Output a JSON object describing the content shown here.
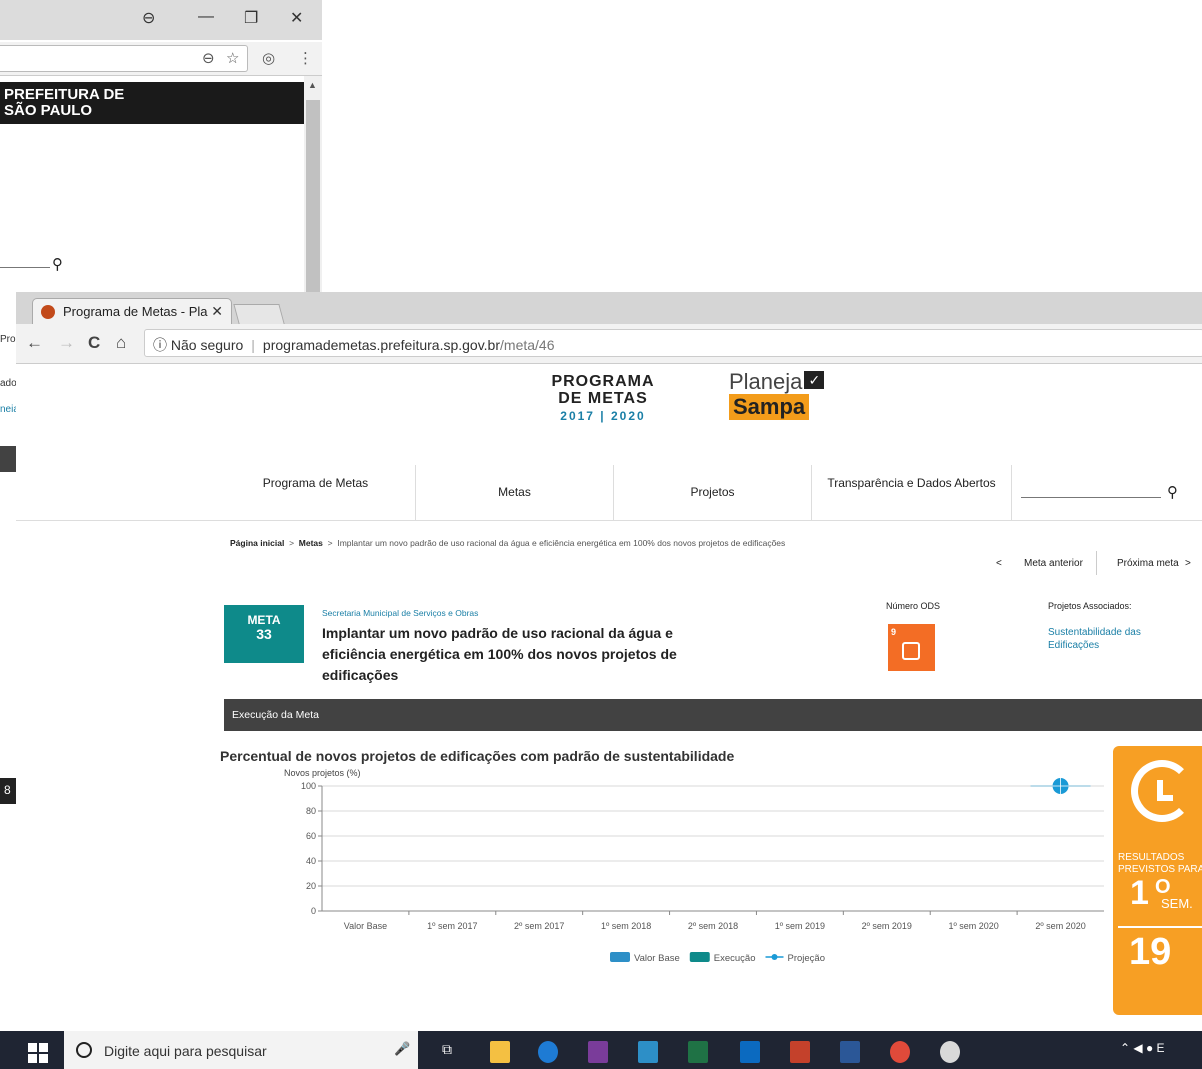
{
  "back_window": {
    "controls": {
      "account": "⊖",
      "minimize": "—",
      "restore": "❐",
      "close": "✕"
    },
    "omnibox_icons": {
      "zoom": "⊖",
      "star": "☆",
      "ext": "◎",
      "menu": "⋮"
    },
    "banner_lines": [
      "PREFEITURA DE",
      "SÃO PAULO"
    ]
  },
  "sliver": {
    "lines": [
      "Pro",
      "ados",
      "neia"
    ],
    "icon": "8"
  },
  "browser": {
    "tab_title": "Programa de Metas - Pla",
    "tab_close": "✕",
    "nav": {
      "back": "←",
      "forward": "→",
      "reload": "C",
      "home": "⌂"
    },
    "url": {
      "security": "ⓘ Não seguro",
      "host": "programademetas.prefeitura.sp.gov.br",
      "path": "/meta/46"
    }
  },
  "logos": {
    "programa": {
      "line1": "PROGRAMA",
      "line2": "DE METAS",
      "years": "2017 | 2020"
    },
    "planeja": {
      "line1": "Planeja",
      "line2": "Sampa"
    }
  },
  "main_nav": {
    "items": [
      "Programa de Metas",
      "Metas",
      "Projetos",
      "Transparência e Dados Abertos"
    ]
  },
  "breadcrumb": {
    "home": "Página inicial",
    "sep": ">",
    "metas": "Metas",
    "current": "Implantar um novo padrão de uso racional da água e eficiência energética em 100% dos novos projetos de edificações"
  },
  "meta_nav": {
    "prev_arrow": "<",
    "prev": "Meta anterior",
    "next": "Próxima meta",
    "next_arrow": ">"
  },
  "meta": {
    "badge_label": "META",
    "badge_number": "33",
    "secretaria": "Secretaria Municipal de Serviços e Obras",
    "title": "Implantar um novo padrão de uso racional da água e eficiência energética em 100% dos novos projetos de edificações",
    "ods_label": "Número ODS",
    "ods_number": "9",
    "projects_label": "Projetos Associados:",
    "projects_link": "Sustentabilidade das Edificações"
  },
  "execution": {
    "header": "Execução da Meta"
  },
  "chart_data": {
    "type": "line",
    "title": "Percentual de novos projetos de edificações com padrão de sustentabilidade",
    "ylabel": "Novos projetos (%)",
    "xlabel": "",
    "ylim": [
      0,
      100
    ],
    "yticks": [
      0,
      20,
      40,
      60,
      80,
      100
    ],
    "categories": [
      "Valor Base",
      "1º sem 2017",
      "2º sem 2017",
      "1º sem 2018",
      "2º sem 2018",
      "1º sem 2019",
      "2º sem 2019",
      "1º sem 2020",
      "2º sem 2020"
    ],
    "series": [
      {
        "name": "Valor Base",
        "kind": "bar",
        "color": "#2d8fc7",
        "values": [
          null,
          null,
          null,
          null,
          null,
          null,
          null,
          null,
          null
        ]
      },
      {
        "name": "Execução",
        "kind": "bar",
        "color": "#0e8a8a",
        "values": [
          null,
          null,
          null,
          null,
          null,
          null,
          null,
          null,
          null
        ]
      },
      {
        "name": "Projeção",
        "kind": "line",
        "color": "#1a9ad6",
        "values": [
          null,
          null,
          null,
          null,
          null,
          null,
          null,
          null,
          100
        ]
      }
    ],
    "grid": true,
    "legend": "bottom"
  },
  "result_card": {
    "label_lines": [
      "RESULTADOS",
      "PREVISTOS PARA"
    ],
    "number": "1",
    "sup": "O",
    "sem": "SEM.",
    "year": "19"
  },
  "taskbar": {
    "search_placeholder": "Digite aqui para pesquisar",
    "mic": "🎤",
    "tray": "⌃ ◀ ● E"
  }
}
